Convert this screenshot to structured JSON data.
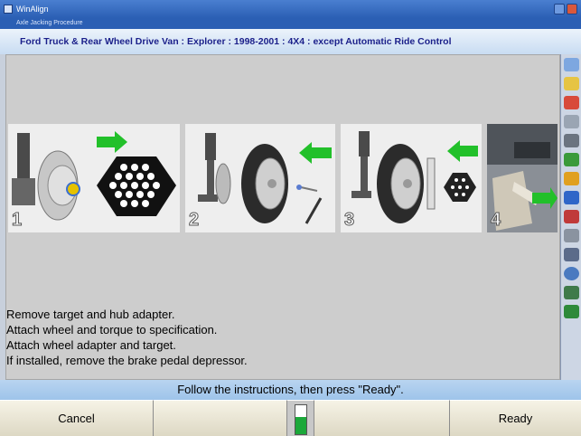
{
  "window": {
    "title": "WinAlign",
    "subtitle": "Axle Jacking Procedure"
  },
  "vehicle": {
    "description": "Ford Truck & Rear Wheel Drive Van : Explorer : 1998-2001 : 4X4 : except Automatic Ride Control"
  },
  "steps": [
    {
      "number": "1"
    },
    {
      "number": "2"
    },
    {
      "number": "3"
    },
    {
      "number": "4"
    }
  ],
  "instructions": [
    "Remove target and hub adapter.",
    "Attach wheel and torque to specification.",
    "Attach wheel adapter and target.",
    "If installed, remove the brake pedal depressor."
  ],
  "prompt": "Follow the instructions, then press \"Ready\".",
  "buttons": {
    "f1": "Cancel",
    "f2": "",
    "f3": "",
    "f4": "Ready"
  },
  "gauge": {
    "level": 0.6
  },
  "sidebar_icons": [
    "alignment-icon",
    "wrench-icon",
    "caster-icon",
    "camber-icon",
    "toe-icon",
    "target-icon",
    "vehicle-lift-icon",
    "measurement-icon",
    "adjust-icon",
    "spec-icon",
    "print-icon",
    "wheel-icon",
    "help-icon",
    "settings-icon"
  ],
  "colors": {
    "vehicle_text": "#1a1f8a",
    "title_bar": "#2b5fb4",
    "arrow_green": "#22c02a"
  }
}
